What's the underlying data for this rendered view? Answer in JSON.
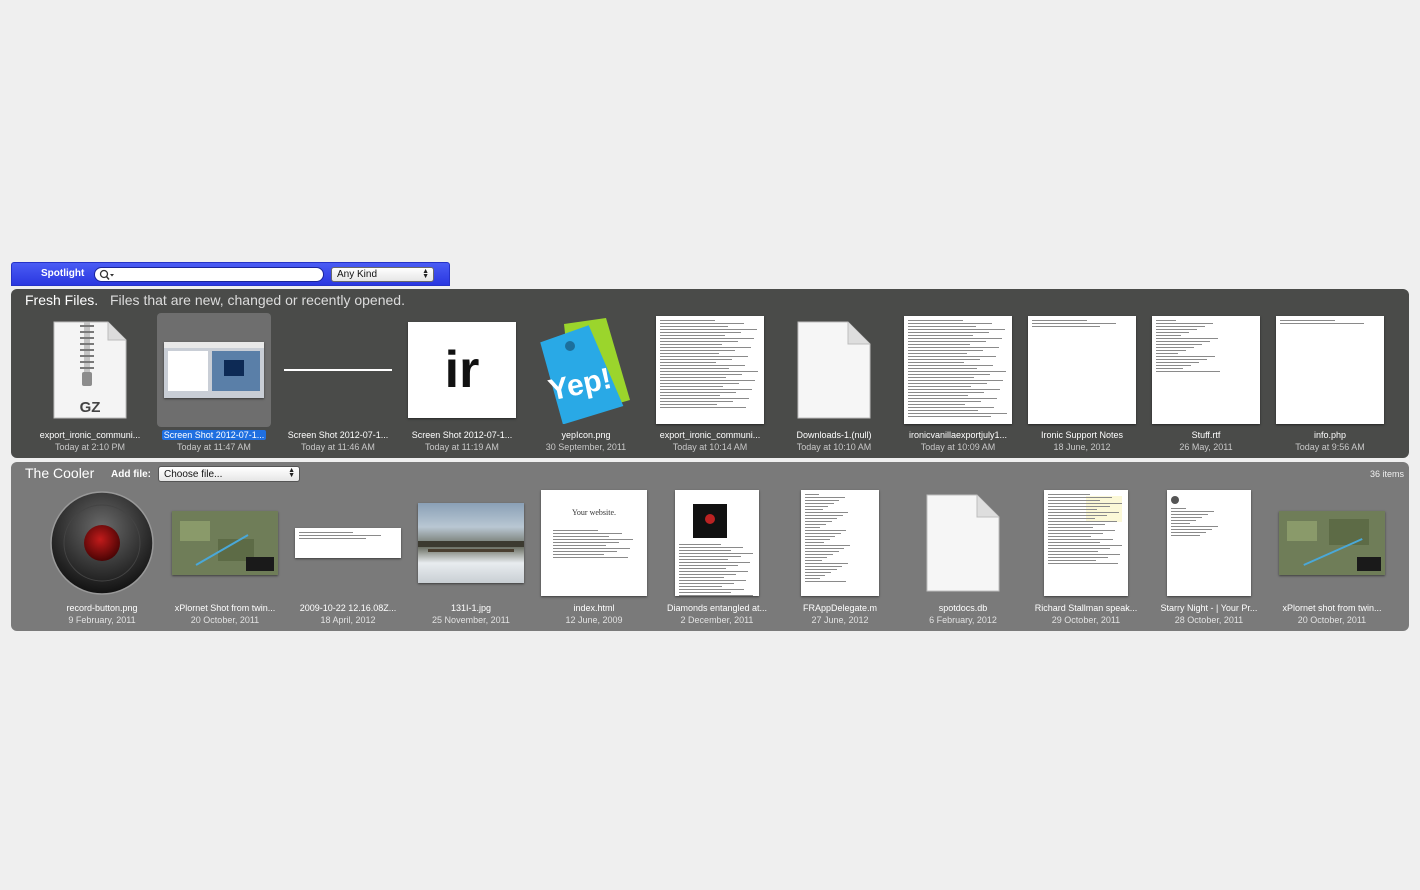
{
  "spotlight": {
    "label": "Spotlight",
    "search_value": "",
    "kind_selected": "Any Kind"
  },
  "fresh": {
    "title": "Fresh Files.",
    "subtitle": "Files that are new, changed or recently opened.",
    "items": [
      {
        "name": "export_ironic_communi...",
        "date": "Today at 2:10 PM",
        "thumb": "gz-archive"
      },
      {
        "name": "Screen Shot 2012-07-1...",
        "date": "Today at 11:47 AM",
        "thumb": "screenshot"
      },
      {
        "name": "Screen Shot 2012-07-1...",
        "date": "Today at 11:46 AM",
        "thumb": "thin-line"
      },
      {
        "name": "Screen Shot 2012-07-1...",
        "date": "Today at 11:19 AM",
        "thumb": "ir-text",
        "thumb_text": "ir"
      },
      {
        "name": "yepIcon.png",
        "date": "30 September, 2011",
        "thumb": "yep-tag",
        "thumb_text": "Yep!"
      },
      {
        "name": "export_ironic_communi...",
        "date": "Today at 10:14 AM",
        "thumb": "text-page"
      },
      {
        "name": "Downloads-1.(null)",
        "date": "Today at 10:10 AM",
        "thumb": "blank-doc"
      },
      {
        "name": "ironicvanillaexportjuly1...",
        "date": "Today at 10:09 AM",
        "thumb": "text-page"
      },
      {
        "name": "Ironic Support Notes",
        "date": "18 June, 2012",
        "thumb": "sparse-page"
      },
      {
        "name": "Stuff.rtf",
        "date": "26 May, 2011",
        "thumb": "list-page"
      },
      {
        "name": "info.php",
        "date": "Today at 9:56 AM",
        "thumb": "sparse-page"
      }
    ]
  },
  "cooler": {
    "title": "The Cooler",
    "add_file_label": "Add file:",
    "choose_value": "Choose file...",
    "count": "36 items",
    "items": [
      {
        "name": "record-button.png",
        "date": "9 February, 2011",
        "thumb": "record-button"
      },
      {
        "name": "xPlornet Shot from twin...",
        "date": "20 October, 2011",
        "thumb": "map"
      },
      {
        "name": "2009-10-22 12.16.08Z...",
        "date": "18 April, 2012",
        "thumb": "wide-doc"
      },
      {
        "name": "131I-1.jpg",
        "date": "25 November, 2011",
        "thumb": "photo"
      },
      {
        "name": "index.html",
        "date": "12 June, 2009",
        "thumb": "website",
        "thumb_text": "Your website."
      },
      {
        "name": "Diamonds entangled at...",
        "date": "2 December, 2011",
        "thumb": "article"
      },
      {
        "name": "FRAppDelegate.m",
        "date": "27 June, 2012",
        "thumb": "text-page"
      },
      {
        "name": "spotdocs.db",
        "date": "6 February, 2012",
        "thumb": "blank-doc"
      },
      {
        "name": "Richard Stallman speak...",
        "date": "29 October, 2011",
        "thumb": "article"
      },
      {
        "name": "Starry Night - | Your Pr...",
        "date": "28 October, 2011",
        "thumb": "sparse-page"
      },
      {
        "name": "xPlornet shot from twin...",
        "date": "20 October, 2011",
        "thumb": "map"
      }
    ]
  }
}
